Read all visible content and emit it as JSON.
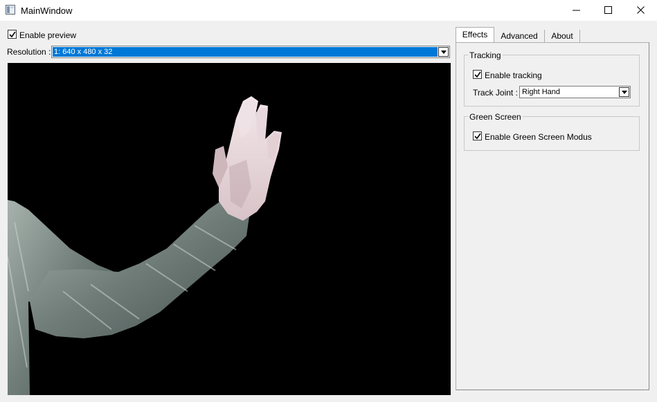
{
  "window": {
    "title": "MainWindow",
    "icons": {
      "app": "app-window-icon",
      "minimize": "minimize-icon",
      "maximize": "maximize-icon",
      "close": "close-icon"
    }
  },
  "preview": {
    "enable_label": "Enable preview",
    "enabled": true,
    "resolution_label": "Resolution :",
    "resolution_value": "1: 640 x 480 x 32",
    "selection_color": "#0078d7"
  },
  "tabs": [
    {
      "label": "Effects",
      "active": true
    },
    {
      "label": "Advanced",
      "active": false
    },
    {
      "label": "About",
      "active": false
    }
  ],
  "tracking": {
    "title": "Tracking",
    "enable_label": "Enable tracking",
    "enabled": true,
    "joint_label": "Track Joint :",
    "joint_value": "Right Hand"
  },
  "green_screen": {
    "title": "Green Screen",
    "enable_label": "Enable Green Screen Modus",
    "enabled": true
  }
}
